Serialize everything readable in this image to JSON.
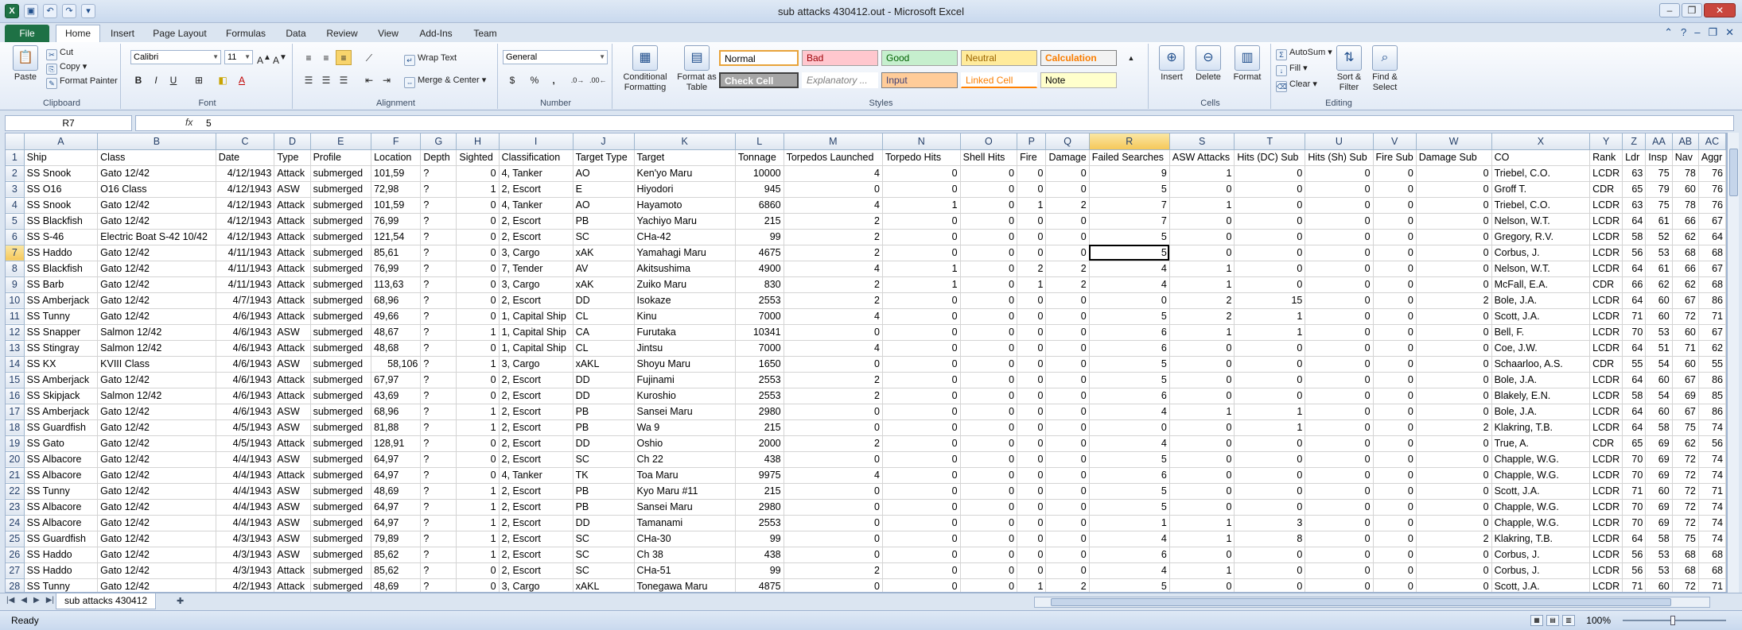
{
  "window": {
    "title": "sub attacks 430412.out  -  Microsoft Excel"
  },
  "ribbon_tabs": {
    "file": "File",
    "items": [
      "Home",
      "Insert",
      "Page Layout",
      "Formulas",
      "Data",
      "Review",
      "View",
      "Add-Ins",
      "Team"
    ]
  },
  "clipboard": {
    "paste": "Paste",
    "cut": "Cut",
    "copy": "Copy",
    "format_painter": "Format Painter",
    "label": "Clipboard"
  },
  "font": {
    "name": "Calibri",
    "size": "11",
    "bold": "B",
    "italic": "I",
    "underline": "U",
    "label": "Font"
  },
  "alignment": {
    "wrap": "Wrap Text",
    "merge": "Merge & Center",
    "label": "Alignment"
  },
  "number": {
    "format": "General",
    "currency": "$",
    "percent": "%",
    "comma": ",",
    "label": "Number"
  },
  "styles": {
    "conditional": "Conditional Formatting",
    "format_table": "Format as Table",
    "cells": [
      "Normal",
      "Bad",
      "Good",
      "Neutral",
      "Calculation",
      "Check Cell",
      "Explanatory ...",
      "Input",
      "Linked Cell",
      "Note"
    ],
    "label": "Styles"
  },
  "cells_grp": {
    "insert": "Insert",
    "delete": "Delete",
    "format": "Format",
    "label": "Cells"
  },
  "editing": {
    "autosum": "AutoSum",
    "fill": "Fill",
    "clear": "Clear",
    "sort": "Sort & Filter",
    "find": "Find & Select",
    "label": "Editing"
  },
  "formula_bar": {
    "name_box": "R7",
    "fx": "fx",
    "value": "5"
  },
  "columns": [
    "A",
    "B",
    "C",
    "D",
    "E",
    "F",
    "G",
    "H",
    "I",
    "J",
    "K",
    "L",
    "M",
    "N",
    "O",
    "P",
    "Q",
    "R",
    "S",
    "T",
    "U",
    "V",
    "W",
    "X",
    "Y",
    "Z",
    "AA",
    "AB",
    "AC"
  ],
  "rows": [
    [
      "Ship",
      "Class",
      "Date",
      "Type",
      "Profile",
      "Location",
      "Depth",
      "Sighted",
      "Classification",
      "Target Type",
      "Target",
      "Tonnage",
      "Torpedos Launched",
      "Torpedo Hits",
      "Shell Hits",
      "Fire",
      "Damage",
      "Failed Searches",
      "ASW Attacks",
      "Hits (DC) Sub",
      "Hits (Sh) Sub",
      "Fire Sub",
      "Damage Sub",
      "CO",
      "Rank",
      "Ldr",
      "Insp",
      "Nav",
      "Aggr"
    ],
    [
      "SS Snook",
      "Gato 12/42",
      "4/12/1943",
      "Attack",
      "submerged",
      "101,59",
      "?",
      "0",
      "4, Tanker",
      "AO",
      "Ken'yo Maru",
      "10000",
      "4",
      "0",
      "0",
      "0",
      "0",
      "9",
      "1",
      "0",
      "0",
      "0",
      "0",
      "Triebel, C.O.",
      "LCDR",
      "63",
      "75",
      "78",
      "76"
    ],
    [
      "SS O16",
      "O16 Class",
      "4/12/1943",
      "ASW",
      "submerged",
      "72,98",
      "?",
      "1",
      "2, Escort",
      "E",
      "Hiyodori",
      "945",
      "0",
      "0",
      "0",
      "0",
      "0",
      "5",
      "0",
      "0",
      "0",
      "0",
      "0",
      "Groff T.",
      "CDR",
      "65",
      "79",
      "60",
      "76"
    ],
    [
      "SS Snook",
      "Gato 12/42",
      "4/12/1943",
      "Attack",
      "submerged",
      "101,59",
      "?",
      "0",
      "4, Tanker",
      "AO",
      "Hayamoto",
      "6860",
      "4",
      "1",
      "0",
      "1",
      "2",
      "7",
      "1",
      "0",
      "0",
      "0",
      "0",
      "Triebel, C.O.",
      "LCDR",
      "63",
      "75",
      "78",
      "76"
    ],
    [
      "SS Blackfish",
      "Gato 12/42",
      "4/12/1943",
      "Attack",
      "submerged",
      "76,99",
      "?",
      "0",
      "2, Escort",
      "PB",
      "Yachiyo Maru",
      "215",
      "2",
      "0",
      "0",
      "0",
      "0",
      "7",
      "0",
      "0",
      "0",
      "0",
      "0",
      "Nelson, W.T.",
      "LCDR",
      "64",
      "61",
      "66",
      "67"
    ],
    [
      "SS S-46",
      "Electric Boat S-42 10/42",
      "4/12/1943",
      "Attack",
      "submerged",
      "121,54",
      "?",
      "0",
      "2, Escort",
      "SC",
      "CHa-42",
      "99",
      "2",
      "0",
      "0",
      "0",
      "0",
      "5",
      "0",
      "0",
      "0",
      "0",
      "0",
      "Gregory, R.V.",
      "LCDR",
      "58",
      "52",
      "62",
      "64"
    ],
    [
      "SS Haddo",
      "Gato 12/42",
      "4/11/1943",
      "Attack",
      "submerged",
      "85,61",
      "?",
      "0",
      "3, Cargo",
      "xAK",
      "Yamahagi Maru",
      "4675",
      "2",
      "0",
      "0",
      "0",
      "0",
      "5",
      "0",
      "0",
      "0",
      "0",
      "0",
      "Corbus, J.",
      "LCDR",
      "56",
      "53",
      "68",
      "68"
    ],
    [
      "SS Blackfish",
      "Gato 12/42",
      "4/11/1943",
      "Attack",
      "submerged",
      "76,99",
      "?",
      "0",
      "7, Tender",
      "AV",
      "Akitsushima",
      "4900",
      "4",
      "1",
      "0",
      "2",
      "2",
      "4",
      "1",
      "0",
      "0",
      "0",
      "0",
      "Nelson, W.T.",
      "LCDR",
      "64",
      "61",
      "66",
      "67"
    ],
    [
      "SS Barb",
      "Gato 12/42",
      "4/11/1943",
      "Attack",
      "submerged",
      "113,63",
      "?",
      "0",
      "3, Cargo",
      "xAK",
      "Zuiko Maru",
      "830",
      "2",
      "1",
      "0",
      "1",
      "2",
      "4",
      "1",
      "0",
      "0",
      "0",
      "0",
      "McFall, E.A.",
      "CDR",
      "66",
      "62",
      "62",
      "68"
    ],
    [
      "SS Amberjack",
      "Gato 12/42",
      "4/7/1943",
      "Attack",
      "submerged",
      "68,96",
      "?",
      "0",
      "2, Escort",
      "DD",
      "Isokaze",
      "2553",
      "2",
      "0",
      "0",
      "0",
      "0",
      "0",
      "2",
      "15",
      "0",
      "0",
      "2",
      "Bole, J.A.",
      "LCDR",
      "64",
      "60",
      "67",
      "86"
    ],
    [
      "SS Tunny",
      "Gato 12/42",
      "4/6/1943",
      "Attack",
      "submerged",
      "49,66",
      "?",
      "0",
      "1, Capital Ship",
      "CL",
      "Kinu",
      "7000",
      "4",
      "0",
      "0",
      "0",
      "0",
      "5",
      "2",
      "1",
      "0",
      "0",
      "0",
      "Scott, J.A.",
      "LCDR",
      "71",
      "60",
      "72",
      "71"
    ],
    [
      "SS Snapper",
      "Salmon 12/42",
      "4/6/1943",
      "ASW",
      "submerged",
      "48,67",
      "?",
      "1",
      "1, Capital Ship",
      "CA",
      "Furutaka",
      "10341",
      "0",
      "0",
      "0",
      "0",
      "0",
      "6",
      "1",
      "1",
      "0",
      "0",
      "0",
      "Bell, F.",
      "LCDR",
      "70",
      "53",
      "60",
      "67"
    ],
    [
      "SS Stingray",
      "Salmon 12/42",
      "4/6/1943",
      "Attack",
      "submerged",
      "48,68",
      "?",
      "0",
      "1, Capital Ship",
      "CL",
      "Jintsu",
      "7000",
      "4",
      "0",
      "0",
      "0",
      "0",
      "6",
      "0",
      "0",
      "0",
      "0",
      "0",
      "Coe, J.W.",
      "LCDR",
      "64",
      "51",
      "71",
      "62"
    ],
    [
      "SS KX",
      "KVIII Class",
      "4/6/1943",
      "ASW",
      "submerged",
      "58,106",
      "?",
      "1",
      "3, Cargo",
      "xAKL",
      "Shoyu Maru",
      "1650",
      "0",
      "0",
      "0",
      "0",
      "0",
      "5",
      "0",
      "0",
      "0",
      "0",
      "0",
      "Schaarloo, A.S.",
      "CDR",
      "55",
      "54",
      "60",
      "55"
    ],
    [
      "SS Amberjack",
      "Gato 12/42",
      "4/6/1943",
      "Attack",
      "submerged",
      "67,97",
      "?",
      "0",
      "2, Escort",
      "DD",
      "Fujinami",
      "2553",
      "2",
      "0",
      "0",
      "0",
      "0",
      "5",
      "0",
      "0",
      "0",
      "0",
      "0",
      "Bole, J.A.",
      "LCDR",
      "64",
      "60",
      "67",
      "86"
    ],
    [
      "SS Skipjack",
      "Salmon 12/42",
      "4/6/1943",
      "Attack",
      "submerged",
      "43,69",
      "?",
      "0",
      "2, Escort",
      "DD",
      "Kuroshio",
      "2553",
      "2",
      "0",
      "0",
      "0",
      "0",
      "6",
      "0",
      "0",
      "0",
      "0",
      "0",
      "Blakely, E.N.",
      "LCDR",
      "58",
      "54",
      "69",
      "85"
    ],
    [
      "SS Amberjack",
      "Gato 12/42",
      "4/6/1943",
      "ASW",
      "submerged",
      "68,96",
      "?",
      "1",
      "2, Escort",
      "PB",
      "Sansei Maru",
      "2980",
      "0",
      "0",
      "0",
      "0",
      "0",
      "4",
      "1",
      "1",
      "0",
      "0",
      "0",
      "Bole, J.A.",
      "LCDR",
      "64",
      "60",
      "67",
      "86"
    ],
    [
      "SS Guardfish",
      "Gato 12/42",
      "4/5/1943",
      "ASW",
      "submerged",
      "81,88",
      "?",
      "1",
      "2, Escort",
      "PB",
      "Wa 9",
      "215",
      "0",
      "0",
      "0",
      "0",
      "0",
      "0",
      "0",
      "1",
      "0",
      "0",
      "2",
      "Klakring, T.B.",
      "LCDR",
      "64",
      "58",
      "75",
      "74"
    ],
    [
      "SS Gato",
      "Gato 12/42",
      "4/5/1943",
      "Attack",
      "submerged",
      "128,91",
      "?",
      "0",
      "2, Escort",
      "DD",
      "Oshio",
      "2000",
      "2",
      "0",
      "0",
      "0",
      "0",
      "4",
      "0",
      "0",
      "0",
      "0",
      "0",
      "True, A.",
      "CDR",
      "65",
      "69",
      "62",
      "56"
    ],
    [
      "SS Albacore",
      "Gato 12/42",
      "4/4/1943",
      "ASW",
      "submerged",
      "64,97",
      "?",
      "0",
      "2, Escort",
      "SC",
      "Ch 22",
      "438",
      "0",
      "0",
      "0",
      "0",
      "0",
      "5",
      "0",
      "0",
      "0",
      "0",
      "0",
      "Chapple, W.G.",
      "LCDR",
      "70",
      "69",
      "72",
      "74"
    ],
    [
      "SS Albacore",
      "Gato 12/42",
      "4/4/1943",
      "Attack",
      "submerged",
      "64,97",
      "?",
      "0",
      "4, Tanker",
      "TK",
      "Toa Maru",
      "9975",
      "4",
      "0",
      "0",
      "0",
      "0",
      "6",
      "0",
      "0",
      "0",
      "0",
      "0",
      "Chapple, W.G.",
      "LCDR",
      "70",
      "69",
      "72",
      "74"
    ],
    [
      "SS Tunny",
      "Gato 12/42",
      "4/4/1943",
      "ASW",
      "submerged",
      "48,69",
      "?",
      "1",
      "2, Escort",
      "PB",
      "Kyo Maru #11",
      "215",
      "0",
      "0",
      "0",
      "0",
      "0",
      "5",
      "0",
      "0",
      "0",
      "0",
      "0",
      "Scott, J.A.",
      "LCDR",
      "71",
      "60",
      "72",
      "71"
    ],
    [
      "SS Albacore",
      "Gato 12/42",
      "4/4/1943",
      "ASW",
      "submerged",
      "64,97",
      "?",
      "1",
      "2, Escort",
      "PB",
      "Sansei Maru",
      "2980",
      "0",
      "0",
      "0",
      "0",
      "0",
      "5",
      "0",
      "0",
      "0",
      "0",
      "0",
      "Chapple, W.G.",
      "LCDR",
      "70",
      "69",
      "72",
      "74"
    ],
    [
      "SS Albacore",
      "Gato 12/42",
      "4/4/1943",
      "ASW",
      "submerged",
      "64,97",
      "?",
      "1",
      "2, Escort",
      "DD",
      "Tamanami",
      "2553",
      "0",
      "0",
      "0",
      "0",
      "0",
      "1",
      "1",
      "3",
      "0",
      "0",
      "0",
      "Chapple, W.G.",
      "LCDR",
      "70",
      "69",
      "72",
      "74"
    ],
    [
      "SS Guardfish",
      "Gato 12/42",
      "4/3/1943",
      "ASW",
      "submerged",
      "79,89",
      "?",
      "1",
      "2, Escort",
      "SC",
      "CHa-30",
      "99",
      "0",
      "0",
      "0",
      "0",
      "0",
      "4",
      "1",
      "8",
      "0",
      "0",
      "2",
      "Klakring, T.B.",
      "LCDR",
      "64",
      "58",
      "75",
      "74"
    ],
    [
      "SS Haddo",
      "Gato 12/42",
      "4/3/1943",
      "ASW",
      "submerged",
      "85,62",
      "?",
      "1",
      "2, Escort",
      "SC",
      "Ch 38",
      "438",
      "0",
      "0",
      "0",
      "0",
      "0",
      "6",
      "0",
      "0",
      "0",
      "0",
      "0",
      "Corbus, J.",
      "LCDR",
      "56",
      "53",
      "68",
      "68"
    ],
    [
      "SS Haddo",
      "Gato 12/42",
      "4/3/1943",
      "Attack",
      "submerged",
      "85,62",
      "?",
      "0",
      "2, Escort",
      "SC",
      "CHa-51",
      "99",
      "2",
      "0",
      "0",
      "0",
      "0",
      "4",
      "1",
      "0",
      "0",
      "0",
      "0",
      "Corbus, J.",
      "LCDR",
      "56",
      "53",
      "68",
      "68"
    ],
    [
      "SS Tunny",
      "Gato 12/42",
      "4/2/1943",
      "Attack",
      "submerged",
      "48,69",
      "?",
      "0",
      "3, Cargo",
      "xAKL",
      "Tonegawa Maru",
      "4875",
      "0",
      "0",
      "0",
      "1",
      "2",
      "5",
      "0",
      "0",
      "0",
      "0",
      "0",
      "Scott, J.A.",
      "LCDR",
      "71",
      "60",
      "72",
      "71"
    ]
  ],
  "sheet_tab": "sub attacks 430412",
  "status": {
    "ready": "Ready",
    "zoom": "100%"
  }
}
